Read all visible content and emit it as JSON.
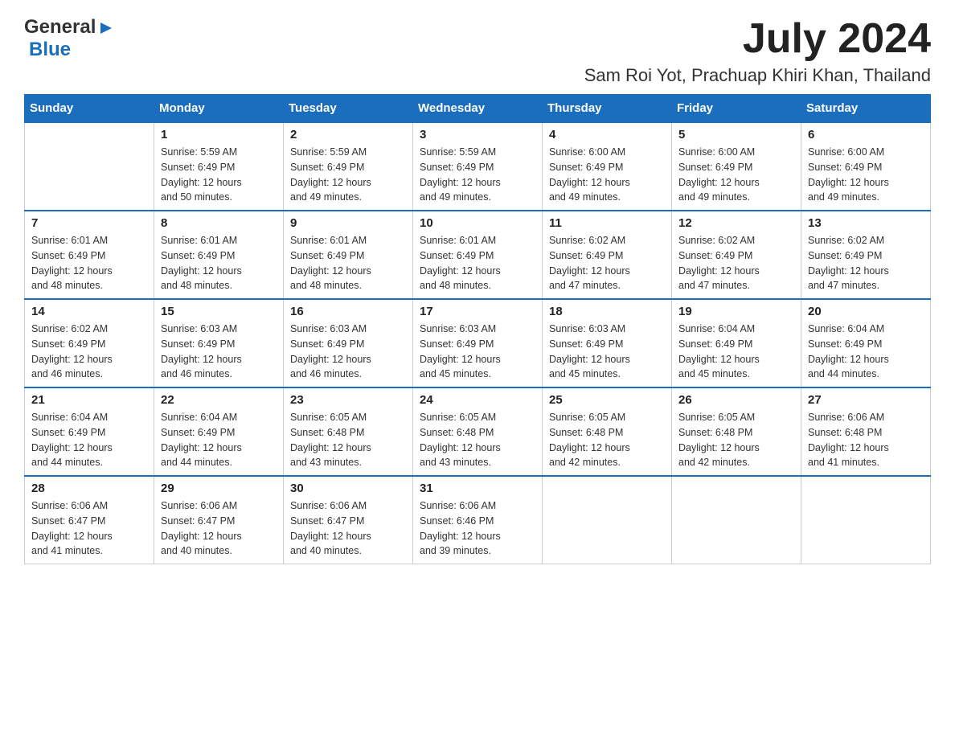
{
  "header": {
    "logo_general": "General",
    "logo_blue": "Blue",
    "month_title": "July 2024",
    "location": "Sam Roi Yot, Prachuap Khiri Khan, Thailand"
  },
  "days_of_week": [
    "Sunday",
    "Monday",
    "Tuesday",
    "Wednesday",
    "Thursday",
    "Friday",
    "Saturday"
  ],
  "weeks": [
    {
      "days": [
        {
          "num": "",
          "info": ""
        },
        {
          "num": "1",
          "info": "Sunrise: 5:59 AM\nSunset: 6:49 PM\nDaylight: 12 hours\nand 50 minutes."
        },
        {
          "num": "2",
          "info": "Sunrise: 5:59 AM\nSunset: 6:49 PM\nDaylight: 12 hours\nand 49 minutes."
        },
        {
          "num": "3",
          "info": "Sunrise: 5:59 AM\nSunset: 6:49 PM\nDaylight: 12 hours\nand 49 minutes."
        },
        {
          "num": "4",
          "info": "Sunrise: 6:00 AM\nSunset: 6:49 PM\nDaylight: 12 hours\nand 49 minutes."
        },
        {
          "num": "5",
          "info": "Sunrise: 6:00 AM\nSunset: 6:49 PM\nDaylight: 12 hours\nand 49 minutes."
        },
        {
          "num": "6",
          "info": "Sunrise: 6:00 AM\nSunset: 6:49 PM\nDaylight: 12 hours\nand 49 minutes."
        }
      ]
    },
    {
      "days": [
        {
          "num": "7",
          "info": "Sunrise: 6:01 AM\nSunset: 6:49 PM\nDaylight: 12 hours\nand 48 minutes."
        },
        {
          "num": "8",
          "info": "Sunrise: 6:01 AM\nSunset: 6:49 PM\nDaylight: 12 hours\nand 48 minutes."
        },
        {
          "num": "9",
          "info": "Sunrise: 6:01 AM\nSunset: 6:49 PM\nDaylight: 12 hours\nand 48 minutes."
        },
        {
          "num": "10",
          "info": "Sunrise: 6:01 AM\nSunset: 6:49 PM\nDaylight: 12 hours\nand 48 minutes."
        },
        {
          "num": "11",
          "info": "Sunrise: 6:02 AM\nSunset: 6:49 PM\nDaylight: 12 hours\nand 47 minutes."
        },
        {
          "num": "12",
          "info": "Sunrise: 6:02 AM\nSunset: 6:49 PM\nDaylight: 12 hours\nand 47 minutes."
        },
        {
          "num": "13",
          "info": "Sunrise: 6:02 AM\nSunset: 6:49 PM\nDaylight: 12 hours\nand 47 minutes."
        }
      ]
    },
    {
      "days": [
        {
          "num": "14",
          "info": "Sunrise: 6:02 AM\nSunset: 6:49 PM\nDaylight: 12 hours\nand 46 minutes."
        },
        {
          "num": "15",
          "info": "Sunrise: 6:03 AM\nSunset: 6:49 PM\nDaylight: 12 hours\nand 46 minutes."
        },
        {
          "num": "16",
          "info": "Sunrise: 6:03 AM\nSunset: 6:49 PM\nDaylight: 12 hours\nand 46 minutes."
        },
        {
          "num": "17",
          "info": "Sunrise: 6:03 AM\nSunset: 6:49 PM\nDaylight: 12 hours\nand 45 minutes."
        },
        {
          "num": "18",
          "info": "Sunrise: 6:03 AM\nSunset: 6:49 PM\nDaylight: 12 hours\nand 45 minutes."
        },
        {
          "num": "19",
          "info": "Sunrise: 6:04 AM\nSunset: 6:49 PM\nDaylight: 12 hours\nand 45 minutes."
        },
        {
          "num": "20",
          "info": "Sunrise: 6:04 AM\nSunset: 6:49 PM\nDaylight: 12 hours\nand 44 minutes."
        }
      ]
    },
    {
      "days": [
        {
          "num": "21",
          "info": "Sunrise: 6:04 AM\nSunset: 6:49 PM\nDaylight: 12 hours\nand 44 minutes."
        },
        {
          "num": "22",
          "info": "Sunrise: 6:04 AM\nSunset: 6:49 PM\nDaylight: 12 hours\nand 44 minutes."
        },
        {
          "num": "23",
          "info": "Sunrise: 6:05 AM\nSunset: 6:48 PM\nDaylight: 12 hours\nand 43 minutes."
        },
        {
          "num": "24",
          "info": "Sunrise: 6:05 AM\nSunset: 6:48 PM\nDaylight: 12 hours\nand 43 minutes."
        },
        {
          "num": "25",
          "info": "Sunrise: 6:05 AM\nSunset: 6:48 PM\nDaylight: 12 hours\nand 42 minutes."
        },
        {
          "num": "26",
          "info": "Sunrise: 6:05 AM\nSunset: 6:48 PM\nDaylight: 12 hours\nand 42 minutes."
        },
        {
          "num": "27",
          "info": "Sunrise: 6:06 AM\nSunset: 6:48 PM\nDaylight: 12 hours\nand 41 minutes."
        }
      ]
    },
    {
      "days": [
        {
          "num": "28",
          "info": "Sunrise: 6:06 AM\nSunset: 6:47 PM\nDaylight: 12 hours\nand 41 minutes."
        },
        {
          "num": "29",
          "info": "Sunrise: 6:06 AM\nSunset: 6:47 PM\nDaylight: 12 hours\nand 40 minutes."
        },
        {
          "num": "30",
          "info": "Sunrise: 6:06 AM\nSunset: 6:47 PM\nDaylight: 12 hours\nand 40 minutes."
        },
        {
          "num": "31",
          "info": "Sunrise: 6:06 AM\nSunset: 6:46 PM\nDaylight: 12 hours\nand 39 minutes."
        },
        {
          "num": "",
          "info": ""
        },
        {
          "num": "",
          "info": ""
        },
        {
          "num": "",
          "info": ""
        }
      ]
    }
  ]
}
